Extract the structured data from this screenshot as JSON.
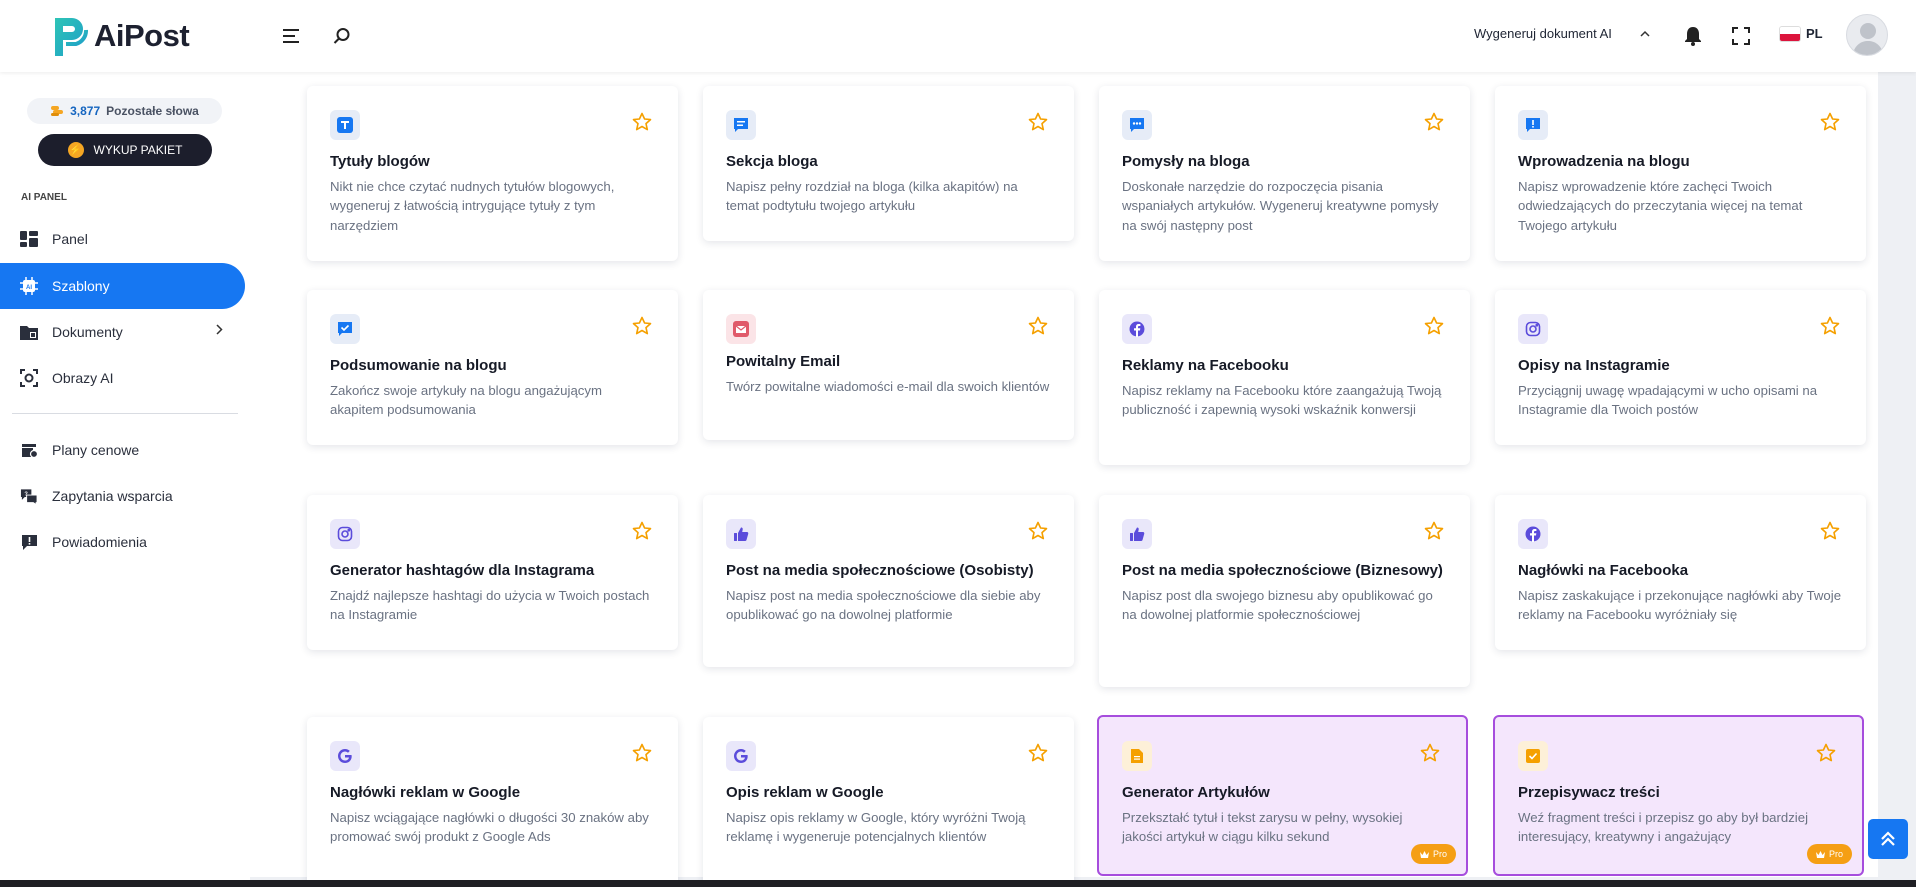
{
  "app": {
    "name": "AiPost"
  },
  "header": {
    "generate_doc_label": "Wygeneruj dokument AI",
    "language": "PL",
    "accent_color": "#1677f2"
  },
  "sidebar": {
    "words_count": "3,877",
    "words_label": "Pozostałe słowa",
    "buy_label": "WYKUP PAKIET",
    "section_title": "AI PANEL",
    "items": [
      {
        "label": "Panel",
        "icon": "dashboard-icon"
      },
      {
        "label": "Szablony",
        "icon": "ai-chip-icon",
        "active": true
      },
      {
        "label": "Dokumenty",
        "icon": "folder-icon"
      },
      {
        "label": "Obrazy AI",
        "icon": "image-scan-icon"
      },
      {
        "label": "Plany cenowe",
        "icon": "pricing-icon"
      },
      {
        "label": "Zapytania wsparcia",
        "icon": "support-chat-icon"
      },
      {
        "label": "Powiadomienia",
        "icon": "notification-icon"
      }
    ]
  },
  "templates": [
    {
      "title": "Tytuły blogów",
      "desc": "Nikt nie chce czytać nudnych tytułów blogowych, wygeneruj z łatwością intrygujące tytuły z tym narzędziem",
      "icon": "text-t-icon"
    },
    {
      "title": "Sekcja bloga",
      "desc": "Napisz pełny rozdział na bloga (kilka akapitów) na temat podtytułu twojego artykułu",
      "icon": "message-lines-icon"
    },
    {
      "title": "Pomysły na bloga",
      "desc": "Doskonałe narzędzie do rozpoczęcia pisania wspaniałych artykułów. Wygeneruj kreatywne pomysły na swój następny post",
      "icon": "chat-dots-icon"
    },
    {
      "title": "Wprowadzenia na blogu",
      "desc": "Napisz wprowadzenie które zachęci Twoich odwiedzających do przeczytania więcej na temat Twojego artykułu",
      "icon": "alert-message-icon"
    },
    {
      "title": "Podsumowanie na blogu",
      "desc": "Zakończ swoje artykuły na blogu angażującym akapitem podsumowania",
      "icon": "check-message-icon"
    },
    {
      "title": "Powitalny Email",
      "desc": "Twórz powitalne wiadomości e-mail dla swoich klientów",
      "icon": "envelope-icon"
    },
    {
      "title": "Reklamy na Facebooku",
      "desc": "Napisz reklamy na Facebooku które zaangażują Twoją publiczność i zapewnią wysoki wskaźnik konwersji",
      "icon": "facebook-icon"
    },
    {
      "title": "Opisy na Instagramie",
      "desc": "Przyciągnij uwagę wpadającymi w ucho opisami na Instagramie dla Twoich postów",
      "icon": "instagram-icon"
    },
    {
      "title": "Generator hashtagów dla Instagrama",
      "desc": "Znajdź najlepsze hashtagi do użycia w Twoich postach na Instagramie",
      "icon": "instagram-icon"
    },
    {
      "title": "Post na media społecznościowe (Osobisty)",
      "desc": "Napisz post na media społecznościowe dla siebie aby opublikować go na dowolnej platformie",
      "icon": "thumbs-up-icon"
    },
    {
      "title": "Post na media społecznościowe (Biznesowy)",
      "desc": "Napisz post dla swojego biznesu aby opublikować go na dowolnej platformie społecznościowej",
      "icon": "thumbs-up-icon"
    },
    {
      "title": "Nagłówki na Facebooka",
      "desc": "Napisz zaskakujące i przekonujące nagłówki aby Twoje reklamy na Facebooku wyróżniały się",
      "icon": "facebook-icon"
    },
    {
      "title": "Nagłówki reklam w Google",
      "desc": "Napisz wciągające nagłówki o długości 30 znaków aby promować swój produkt z Google Ads",
      "icon": "google-icon"
    },
    {
      "title": "Opis reklam w Google",
      "desc": "Napisz opis reklamy w Google, który wyróżni Twoją reklamę i wygeneruje potencjalnych klientów",
      "icon": "google-icon"
    },
    {
      "title": "Generator Artykułów",
      "desc": "Przekształć tytuł i tekst zarysu w pełny, wysokiej jakości artykuł w ciągu kilku sekund",
      "icon": "document-icon",
      "pro": true,
      "pro_label": "Pro"
    },
    {
      "title": "Przepisywacz treści",
      "desc": "Weź fragment treści i przepisz go aby był bardziej interesujący, kreatywny i angażujący",
      "icon": "checkbox-doc-icon",
      "pro": true,
      "pro_label": "Pro"
    }
  ]
}
